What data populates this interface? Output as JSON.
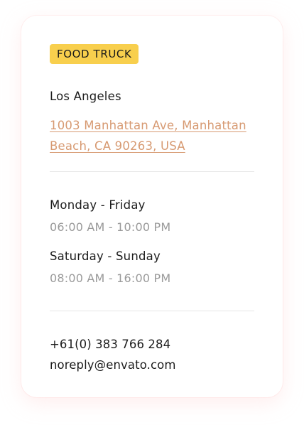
{
  "card": {
    "badge": "FOOD TRUCK",
    "city": "Los Angeles",
    "address": "1003 Manhattan Ave, Manhattan Beach, CA 90263, USA",
    "schedule": [
      {
        "days": "Monday - Friday",
        "hours": "06:00 AM - 10:00 PM"
      },
      {
        "days": "Saturday - Sunday",
        "hours": "08:00 AM - 16:00 PM"
      }
    ],
    "phone": "+61(0) 383 766 284",
    "email": "noreply@envato.com"
  },
  "colors": {
    "badge_bg": "#f8cf4d",
    "link": "#d79a72",
    "muted": "#9a9a9a",
    "text": "#1d1d1d",
    "divider": "#e6e6e6"
  }
}
